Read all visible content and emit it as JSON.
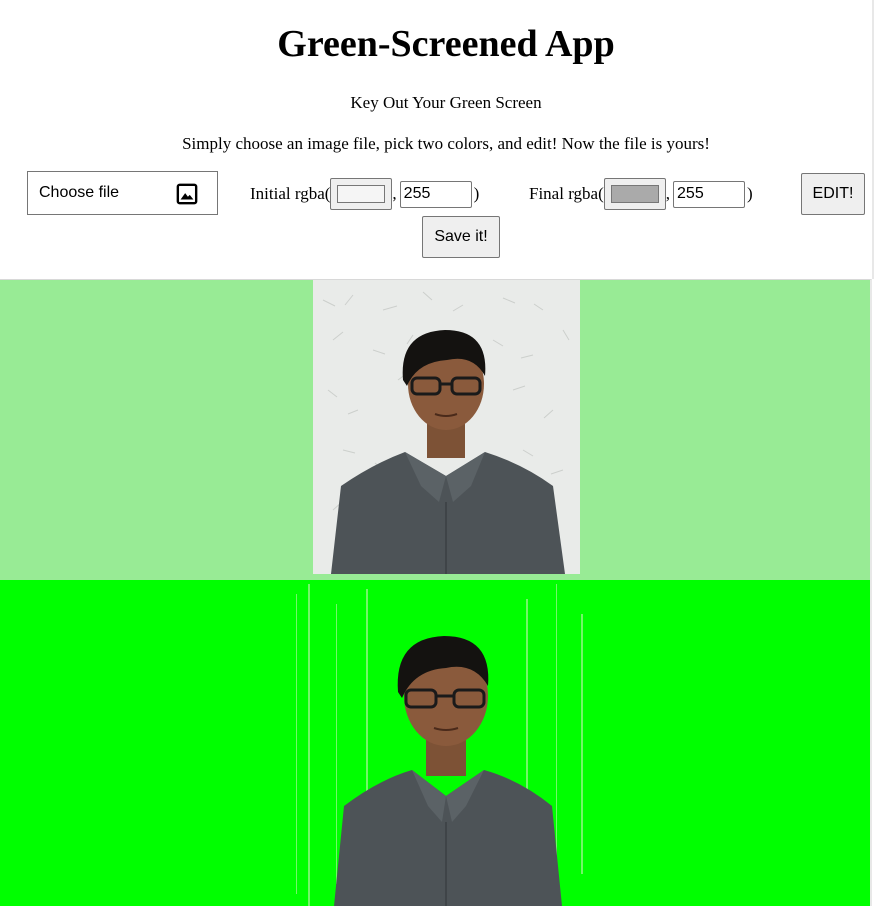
{
  "header": {
    "title": "Green-Screened App",
    "subtitle": "Key Out Your Green Screen",
    "description": "Simply choose an image file, pick two colors, and edit! Now the file is yours!"
  },
  "controls": {
    "file_label": "Choose file",
    "file_icon": "image-icon",
    "initial": {
      "label": "Initial rgba(",
      "color": "#f5f5f5",
      "separator": ",",
      "alpha": "255",
      "close": ")"
    },
    "final": {
      "label": "Final rgba(",
      "color": "#aaaaaa",
      "separator": ",",
      "alpha": "255",
      "close": ")"
    },
    "edit_label": "EDIT!",
    "save_label": "Save it!"
  },
  "colors": {
    "original_canvas_bg": "#98eb95",
    "edited_canvas_bg": "#00ff00",
    "wall": "#e9ebe9",
    "shirt": "#4d5357",
    "skin": "#8a5a3c",
    "hair": "#141210"
  }
}
